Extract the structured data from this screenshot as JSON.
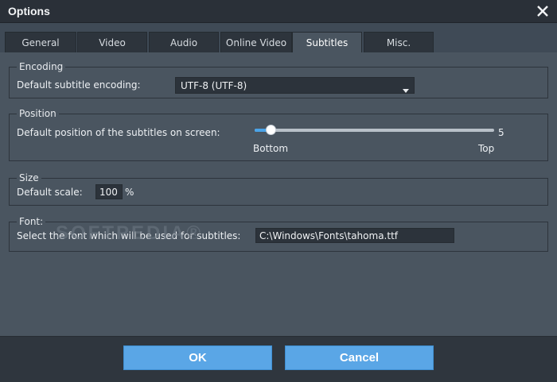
{
  "window": {
    "title": "Options"
  },
  "tabs": [
    {
      "label": "General"
    },
    {
      "label": "Video"
    },
    {
      "label": "Audio"
    },
    {
      "label": "Online Video"
    },
    {
      "label": "Subtitles",
      "active": true
    },
    {
      "label": "Misc."
    }
  ],
  "encoding": {
    "legend": "Encoding",
    "label": "Default subtitle encoding:",
    "value": "UTF-8 (UTF-8)"
  },
  "position": {
    "legend": "Position",
    "label": "Default position of the subtitles on screen:",
    "value": 5,
    "min_label": "Bottom",
    "max_label": "Top",
    "value_text": "5",
    "level_fraction": 0.05
  },
  "size": {
    "legend": "Size",
    "label": "Default scale:",
    "value": "100",
    "unit": "%"
  },
  "font": {
    "legend": "Font:",
    "label": "Select the font which will be used for subtitles:",
    "value": "C:\\Windows\\Fonts\\tahoma.ttf"
  },
  "buttons": {
    "ok": "OK",
    "cancel": "Cancel"
  },
  "watermark": "SOFTPEDIA®",
  "colors": {
    "accent": "#5aa6e6",
    "background": "#4a5560",
    "titlebar": "#2a3038"
  }
}
